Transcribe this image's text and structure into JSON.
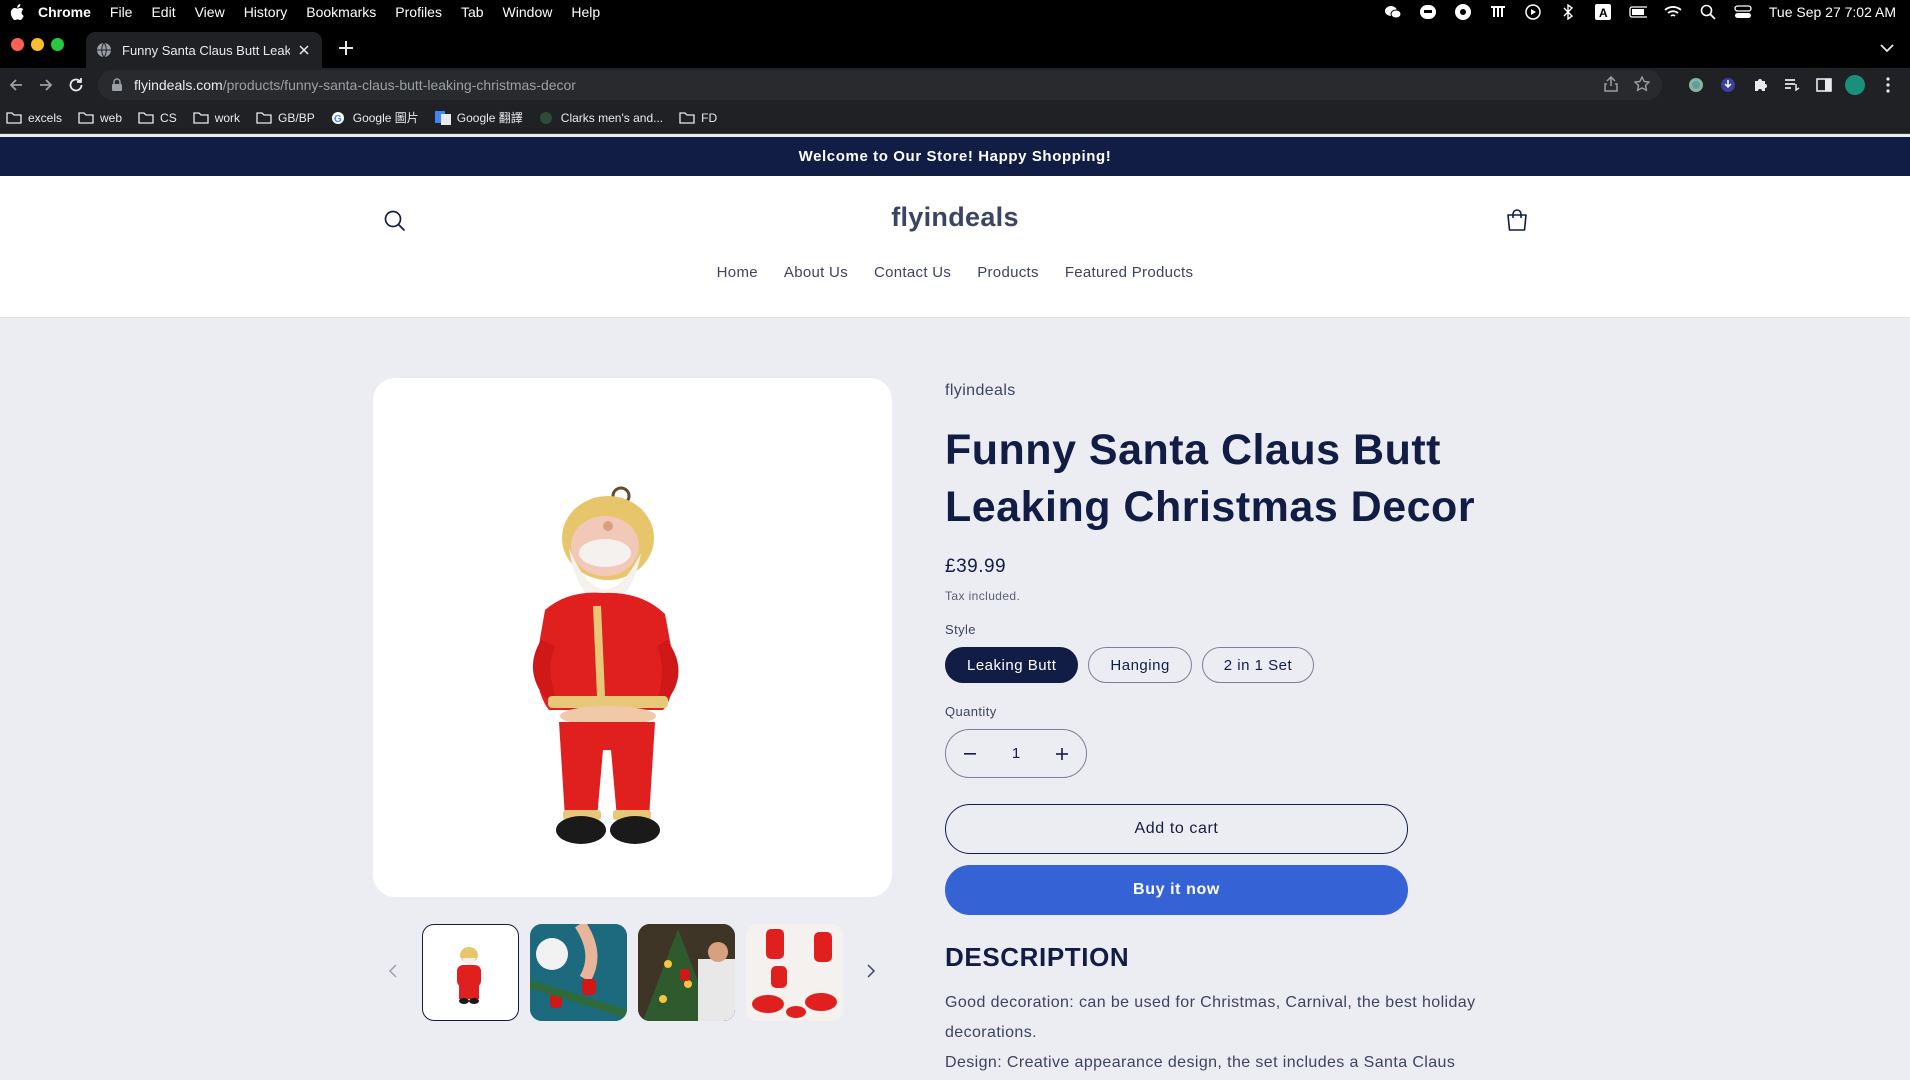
{
  "menubar": {
    "app": "Chrome",
    "items": [
      "File",
      "Edit",
      "View",
      "History",
      "Bookmarks",
      "Profiles",
      "Tab",
      "Window",
      "Help"
    ],
    "clock": "Tue Sep 27  7:02 AM"
  },
  "browser": {
    "tab_title": "Funny Santa Claus Butt Leaking Christmas Decor",
    "url_domain": "flyindeals.com",
    "url_path": "/products/funny-santa-claus-butt-leaking-christmas-decor",
    "bookmarks": [
      "excels",
      "web",
      "CS",
      "work",
      "GB/BP",
      "Google 圖片",
      "Google 翻譯",
      "Clarks men's and...",
      "FD"
    ]
  },
  "store": {
    "announcement": "Welcome to Our Store! Happy Shopping!",
    "logo": "flyindeals",
    "nav": [
      "Home",
      "About Us",
      "Contact Us",
      "Products",
      "Featured Products"
    ]
  },
  "product": {
    "vendor": "flyindeals",
    "title": "Funny Santa Claus Butt Leaking Christmas Decor",
    "price": "£39.99",
    "tax_note": "Tax included.",
    "style_label": "Style",
    "styles": [
      "Leaking Butt",
      "Hanging",
      "2 in 1 Set"
    ],
    "selected_style": "Leaking Butt",
    "quantity_label": "Quantity",
    "quantity": "1",
    "add_to_cart": "Add to cart",
    "buy_now": "Buy it now",
    "description_title": "DESCRIPTION",
    "description_lines": [
      "Good decoration: can be used for Christmas, Carnival, the best holiday decorations.",
      "Design: Creative appearance design, the set includes a Santa Claus"
    ]
  },
  "colors": {
    "announcement_bg": "#121d46",
    "primary_text": "#121d46",
    "buy_button": "#3562d4",
    "page_bg": "#ecedf2"
  }
}
